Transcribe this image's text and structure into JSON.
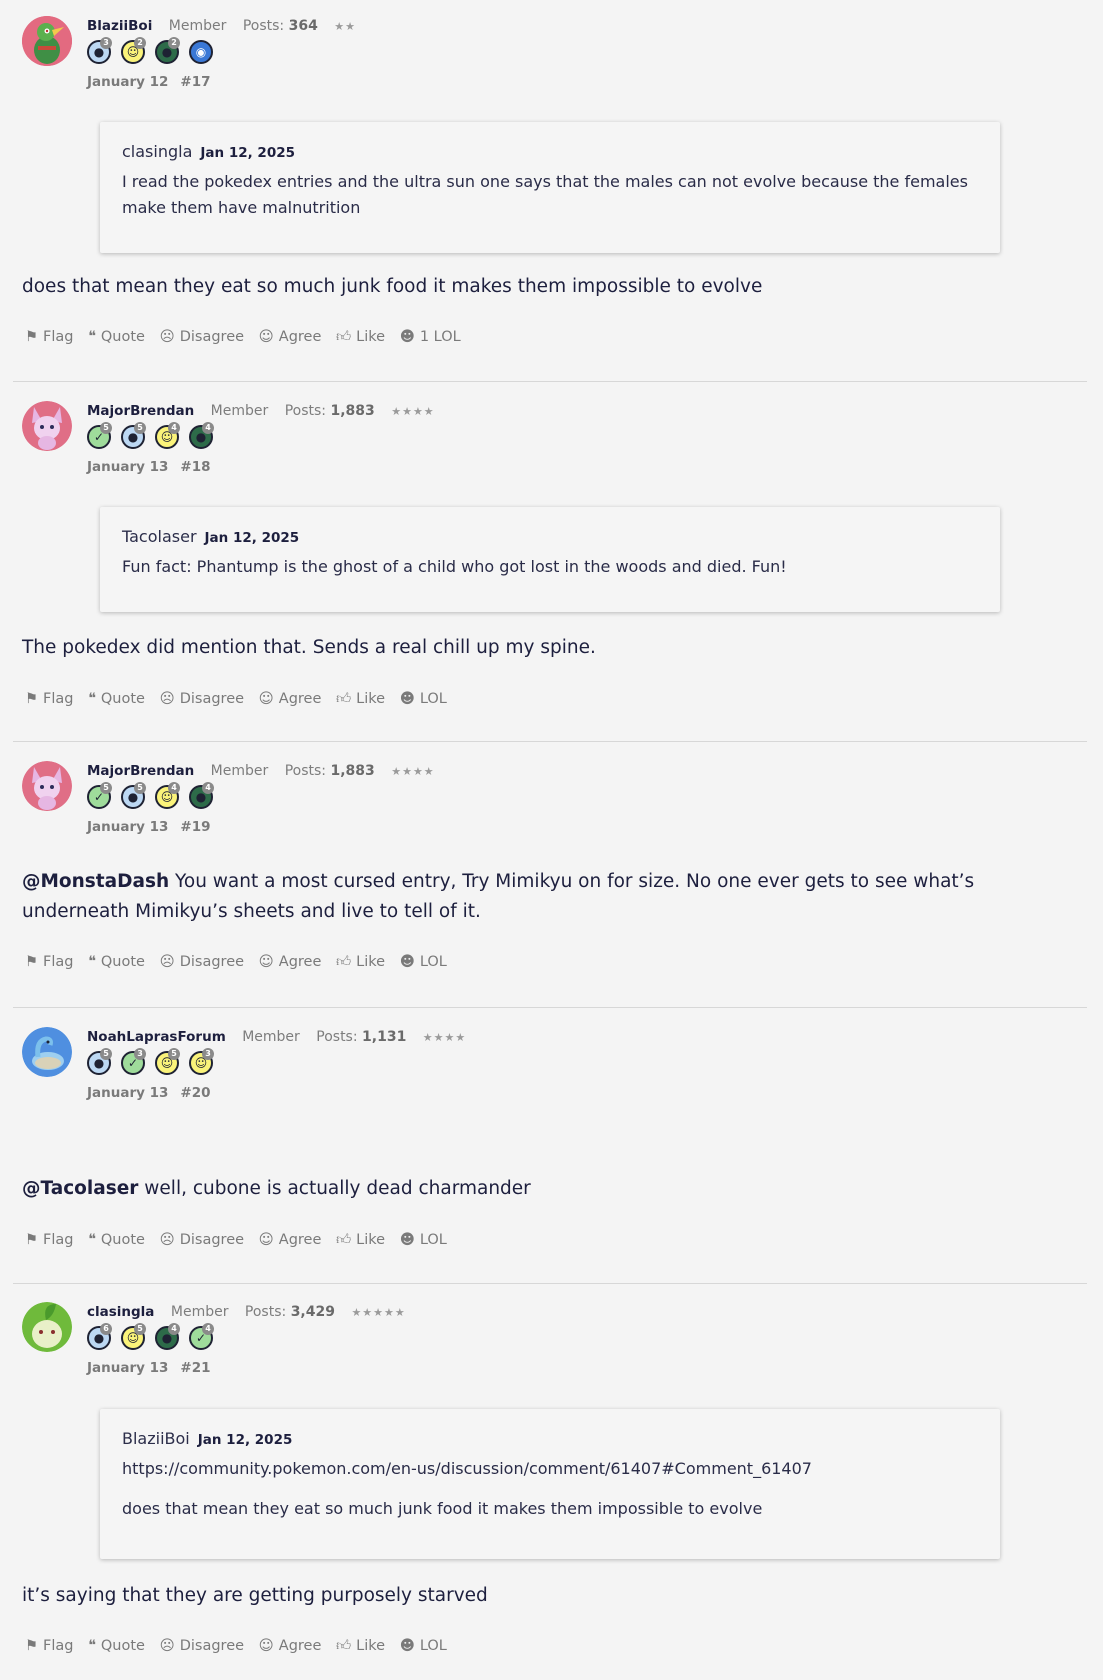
{
  "posts": [
    {
      "username": "BlaziiBoi",
      "role": "Member",
      "posts_label": "Posts:",
      "posts_count": "364",
      "stars": "★★",
      "badges": [
        {
          "icon": "comment-icon",
          "color": "b-blue",
          "count": "3",
          "glyph": "●"
        },
        {
          "icon": "wink-icon",
          "color": "b-yellow",
          "count": "2",
          "glyph": "☺"
        },
        {
          "icon": "thumbs-up-icon",
          "color": "b-teal",
          "count": "2",
          "glyph": "●"
        },
        {
          "icon": "camera-icon",
          "color": "b-cam",
          "count": "",
          "glyph": "◉"
        }
      ],
      "date": "January 12",
      "post_num": "#17",
      "quote": {
        "author": "clasingla",
        "date": "Jan 12, 2025",
        "lines": [
          "I read the pokedex entries and the ultra sun one says that the males can not evolve because the females make them have malnutrition"
        ]
      },
      "body_mention": "",
      "body": "does that mean they eat so much junk food it makes them impossible to evolve",
      "lol_label": "1 LOL"
    },
    {
      "username": "MajorBrendan",
      "role": "Member",
      "posts_label": "Posts:",
      "posts_count": "1,883",
      "stars": "★★★★",
      "date": "January 13",
      "post_num": "#18",
      "quote": {
        "author": "Tacolaser",
        "date": "Jan 12, 2025",
        "lines": [
          "Fun fact: Phantump is the ghost of a child who got lost in the woods and died. Fun!"
        ]
      },
      "body_mention": "",
      "body": "The pokedex did mention that. Sends a real chill up my spine.",
      "lol_label": "LOL"
    },
    {
      "username": "MajorBrendan",
      "role": "Member",
      "posts_label": "Posts:",
      "posts_count": "1,883",
      "stars": "★★★★",
      "date": "January 13",
      "post_num": "#19",
      "body_mention": "@MonstaDash",
      "body": " You want a most cursed entry, Try Mimikyu on for size. No one ever gets to see what’s underneath Mimikyu’s sheets and live to tell of it.",
      "lol_label": "LOL"
    },
    {
      "username": "NoahLaprasForum",
      "role": "Member",
      "posts_label": "Posts:",
      "posts_count": "1,131",
      "stars": "★★★★",
      "date": "January 13",
      "post_num": "#20",
      "body_mention": "@Tacolaser",
      "body": " well, cubone is actually dead charmander",
      "lol_label": "LOL"
    },
    {
      "username": "clasingla",
      "role": "Member",
      "posts_label": "Posts:",
      "posts_count": "3,429",
      "stars": "★★★★★",
      "date": "January 13",
      "post_num": "#21",
      "quote": {
        "author": "BlaziiBoi",
        "date": "Jan 12, 2025",
        "lines": [
          "https://community.pokemon.com/en-us/discussion/comment/61407#Comment_61407",
          "does that mean they eat so much junk food it makes them impossible to evolve"
        ]
      },
      "body_mention": "",
      "body": "it’s saying that they are getting purposely starved",
      "lol_label": "LOL"
    }
  ],
  "actions": {
    "flag": "Flag",
    "quote": "Quote",
    "disagree": "Disagree",
    "agree": "Agree",
    "like": "Like"
  },
  "badge_counts": {
    "p18": [
      "5",
      "5",
      "4",
      "4"
    ],
    "p20": [
      "5",
      "3",
      "5",
      "3"
    ],
    "p21": [
      "6",
      "5",
      "4",
      "4"
    ]
  }
}
